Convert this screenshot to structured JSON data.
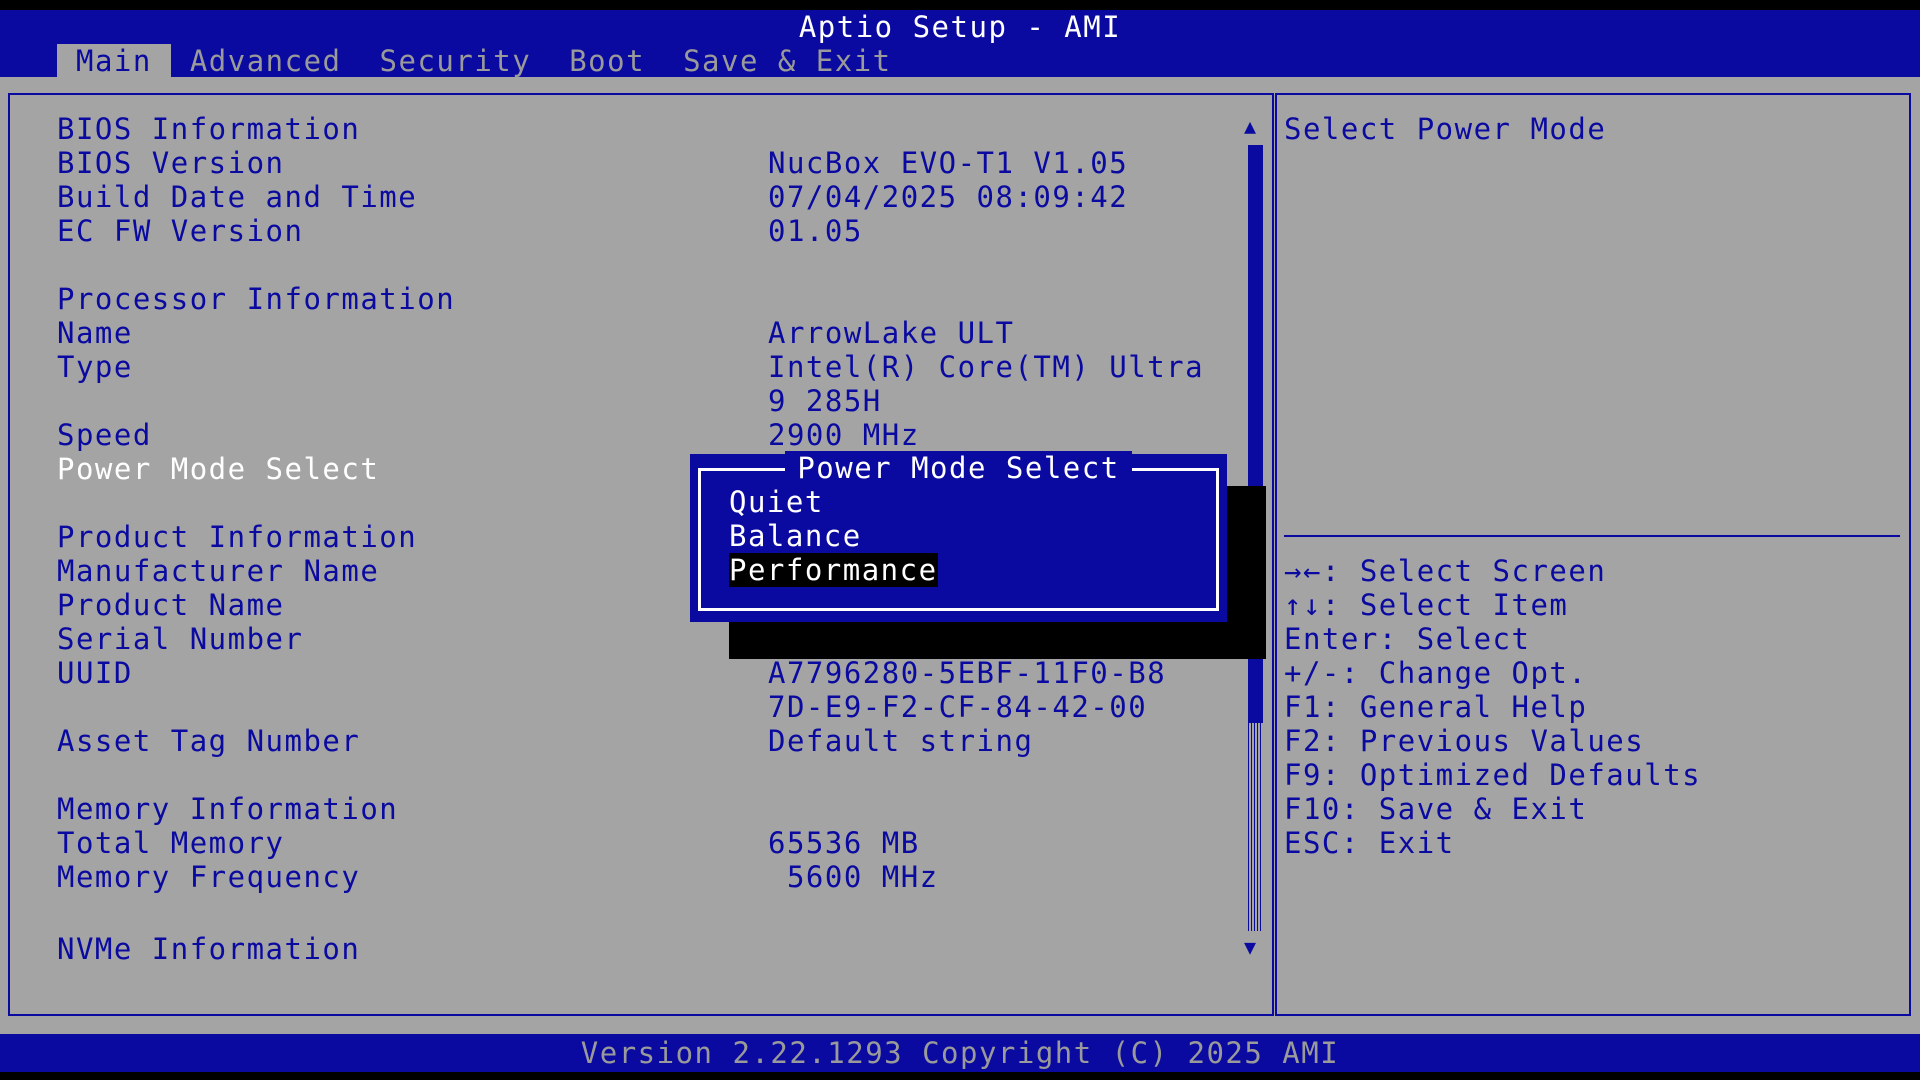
{
  "header": {
    "title": "Aptio Setup - AMI",
    "tabs": [
      {
        "label": "Main",
        "active": true
      },
      {
        "label": "Advanced",
        "active": false
      },
      {
        "label": "Security",
        "active": false
      },
      {
        "label": "Boot",
        "active": false
      },
      {
        "label": "Save & Exit",
        "active": false
      }
    ]
  },
  "main": {
    "bios_info": {
      "heading": "BIOS Information",
      "version_label": "BIOS Version",
      "version_value": "NucBox EVO-T1 V1.05",
      "build_label": "Build Date and Time",
      "build_value": "07/04/2025 08:09:42",
      "ec_label": "EC FW Version",
      "ec_value": "01.05"
    },
    "processor_info": {
      "heading": "Processor Information",
      "name_label": "Name",
      "name_value": "ArrowLake ULT",
      "type_label": "Type",
      "type_value_line1": "Intel(R) Core(TM) Ultra",
      "type_value_line2": "9 285H",
      "speed_label": "Speed",
      "speed_value": "2900 MHz",
      "power_mode_label": "Power Mode Select"
    },
    "product_info": {
      "heading": "Product Information",
      "manufacturer_label": "Manufacturer Name",
      "product_name_label": "Product Name",
      "serial_label": "Serial Number",
      "uuid_label": "UUID",
      "uuid_value_line1": "A7796280-5EBF-11F0-B8",
      "uuid_value_line2": "7D-E9-F2-CF-84-42-00",
      "asset_label": "Asset Tag Number",
      "asset_value": "Default string"
    },
    "memory_info": {
      "heading": "Memory Information",
      "total_label": "Total Memory",
      "total_value": "65536 MB",
      "freq_label": "Memory Frequency",
      "freq_value": " 5600 MHz"
    },
    "nvme_info": {
      "heading": "NVMe Information"
    }
  },
  "popup": {
    "title": "Power Mode Select",
    "options": [
      "Quiet",
      "Balance",
      "Performance"
    ],
    "selected": "Performance"
  },
  "help": {
    "description": "Select Power Mode",
    "keys": [
      "→←: Select Screen",
      "↑↓: Select Item",
      "Enter: Select",
      "+/-: Change Opt.",
      "F1: General Help",
      "F2: Previous Values",
      "F9: Optimized Defaults",
      "F10: Save & Exit",
      "ESC: Exit"
    ]
  },
  "footer": {
    "text": "Version 2.22.1293 Copyright (C) 2025 AMI"
  },
  "colors": {
    "bios_blue": "#0a0aa0",
    "panel_gray": "#a4a4a4",
    "tab_inactive": "#9a9a9a",
    "highlight_white": "#ffffff"
  },
  "icons": {
    "scroll_up": "scroll-up-arrow-icon",
    "scroll_down": "scroll-down-arrow-icon"
  }
}
